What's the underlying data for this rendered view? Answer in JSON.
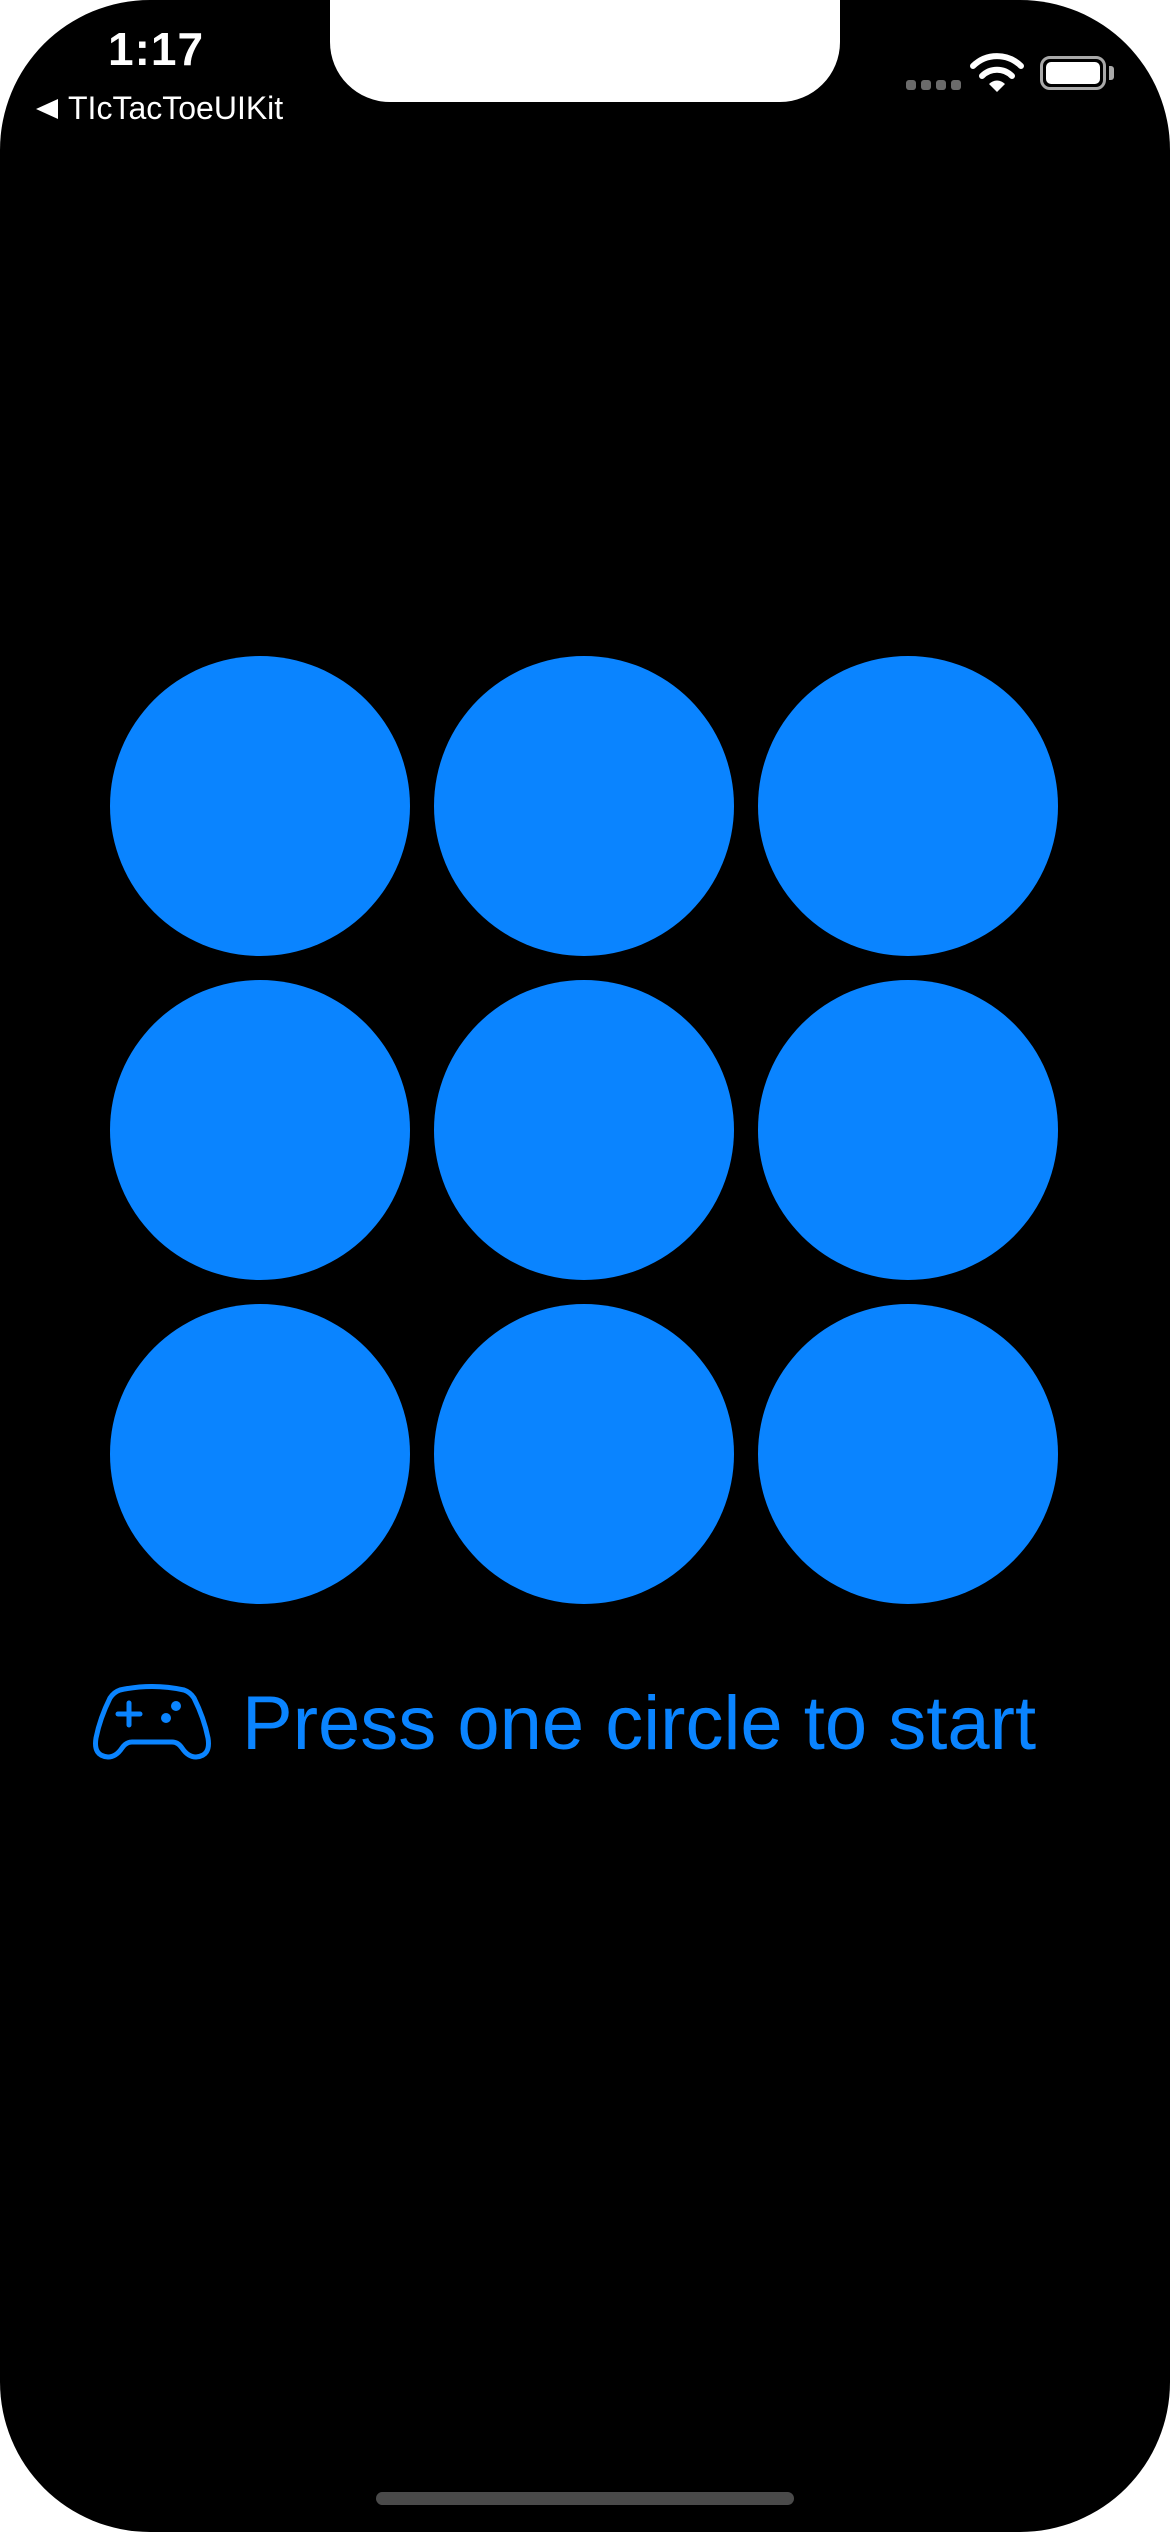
{
  "status_bar": {
    "time": "1:17",
    "wifi_icon": "wifi-icon",
    "battery_icon": "battery-icon",
    "signal_icon": "cellular-signal-icon"
  },
  "back_navigation": {
    "label": "TIcTacToeUIKit",
    "icon": "back-triangle-icon"
  },
  "board": {
    "cell_color": "#0a84ff",
    "rows": 3,
    "columns": 3,
    "cells": [
      "",
      "",
      "",
      "",
      "",
      "",
      "",
      "",
      ""
    ]
  },
  "prompt": {
    "icon": "gamecontroller-icon",
    "text": "Press one circle to start",
    "color": "#0a84ff"
  },
  "colors": {
    "background": "#000000",
    "accent": "#0a84ff"
  }
}
